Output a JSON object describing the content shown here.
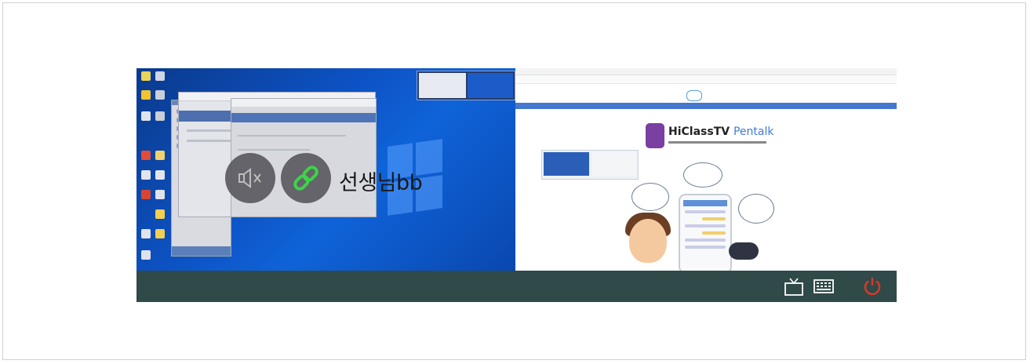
{
  "session": {
    "participant_name": "선생님bb"
  },
  "left_screen": {
    "controls": {
      "mute_icon": "speaker-muted-icon",
      "link_icon": "link-icon"
    }
  },
  "right_screen": {
    "brand_title": "HiClassTV",
    "brand_subtitle": "Pentalk"
  },
  "taskbar": {
    "icons": [
      "tv-icon",
      "keyboard-icon",
      "power-icon"
    ]
  },
  "colors": {
    "taskbar_bg": "#2f4a48",
    "power_red": "#d23a2a",
    "link_green": "#3fd24a",
    "desktop_blue": "#0d52c4"
  }
}
